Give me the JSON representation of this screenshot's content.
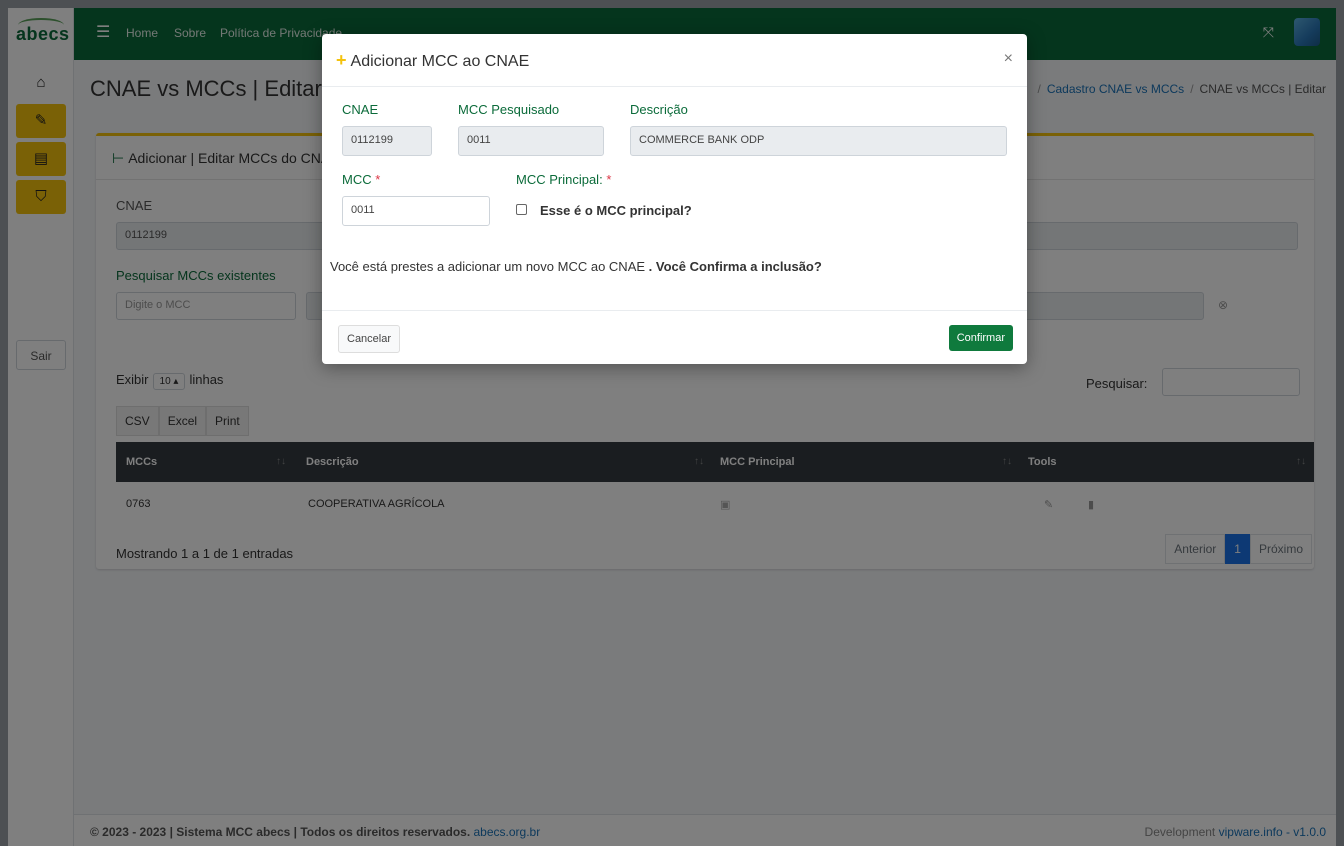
{
  "header": {
    "logo_text": "abecs",
    "nav": [
      {
        "label": "Home"
      },
      {
        "label": "Sobre"
      },
      {
        "label": "Política de Privacidade"
      }
    ]
  },
  "sidebar": {
    "items": [
      {
        "icon": "home-icon",
        "glyph": "⌂"
      },
      {
        "icon": "edit-icon",
        "glyph": "✎"
      },
      {
        "icon": "server-icon",
        "glyph": "▤"
      },
      {
        "icon": "shield-icon",
        "glyph": "⛉"
      }
    ],
    "logout_label": "Sair"
  },
  "page": {
    "title": "CNAE vs MCCs | Editar",
    "breadcrumb": {
      "link": "Cadastro CNAE vs MCCs",
      "current": "CNAE vs MCCs | Editar"
    }
  },
  "card": {
    "title": "Adicionar | Editar MCCs do CNAE",
    "cnae_label": "CNAE",
    "cnae_value": "0112199",
    "search_label": "Pesquisar MCCs existentes",
    "search_placeholder": "Digite o MCC",
    "exibir_label": "Exibir",
    "exibir_value": "10",
    "linhas_label": "linhas",
    "pesquisar_label": "Pesquisar:",
    "export_buttons": [
      "CSV",
      "Excel",
      "Print"
    ],
    "table": {
      "columns": [
        "MCCs",
        "Descrição",
        "MCC Principal",
        "Tools"
      ],
      "rows": [
        {
          "mcc": "0763",
          "descricao": "COOPERATIVA AGRÍCOLA"
        }
      ]
    },
    "mostrando": "Mostrando 1 a 1 de 1 entradas",
    "pager": {
      "prev": "Anterior",
      "current": "1",
      "next": "Próximo"
    }
  },
  "footer": {
    "left_text": "© 2023 - 2023 | Sistema MCC abecs | Todos os direitos reservados.",
    "left_link": "abecs.org.br",
    "right_text": "Development",
    "right_link": "vipware.info - v1.0.0"
  },
  "modal": {
    "title": "Adicionar MCC ao CNAE",
    "close_glyph": "×",
    "fields": {
      "cnae_label": "CNAE",
      "cnae_value": "0112199",
      "mcc_pesq_label": "MCC Pesquisado",
      "mcc_pesq_value": "0011",
      "descricao_label": "Descrição",
      "descricao_value": "COMMERCE BANK ODP",
      "mcc_label": "MCC",
      "mcc_value": "0011",
      "mcc_principal_label": "MCC Principal:",
      "checkbox_label": "Esse é o MCC principal?",
      "required_mark": "*"
    },
    "message_prefix": "Você está prestes a adicionar um novo MCC ao CNAE",
    "message_bold": ". Você Confirma a inclusão?",
    "cancel_label": "Cancelar",
    "confirm_label": "Confirmar"
  }
}
